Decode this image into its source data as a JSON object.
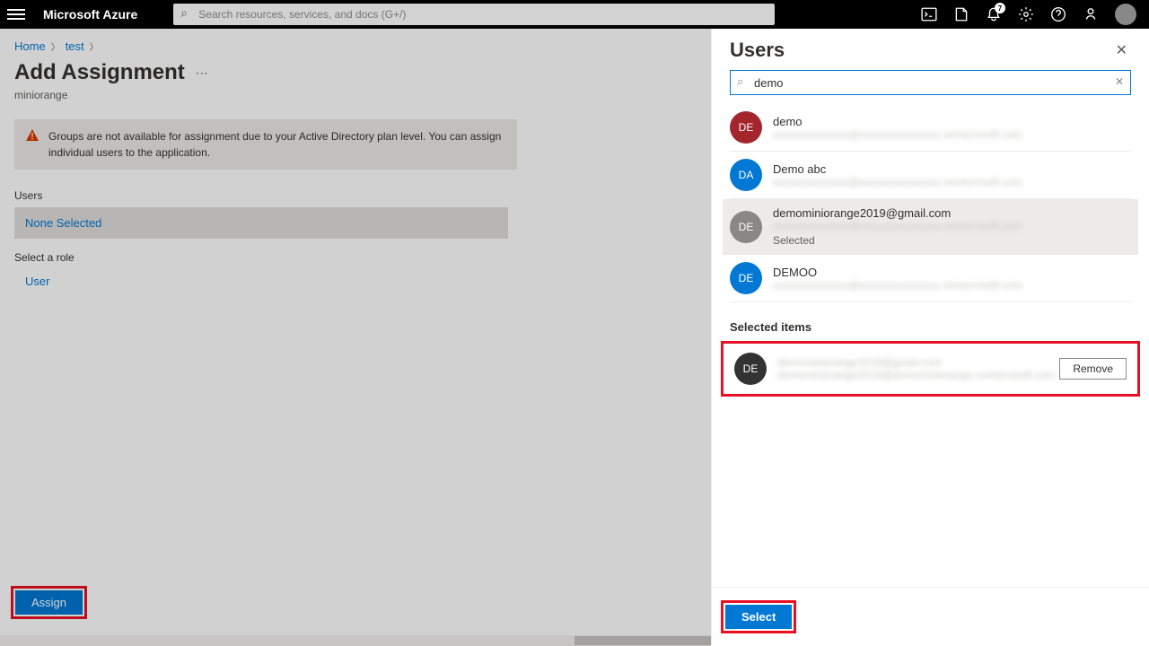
{
  "topbar": {
    "brand": "Microsoft Azure",
    "search_placeholder": "Search resources, services, and docs (G+/)",
    "notification_count": "7"
  },
  "breadcrumb": {
    "items": [
      "Home",
      "test"
    ]
  },
  "page": {
    "title": "Add Assignment",
    "subtitle": "miniorange",
    "warning": "Groups are not available for assignment due to your Active Directory plan level. You can assign individual users to the application."
  },
  "form": {
    "users_label": "Users",
    "users_value": "None Selected",
    "role_label": "Select a role",
    "role_value": "User"
  },
  "buttons": {
    "assign": "Assign",
    "select": "Select",
    "remove": "Remove"
  },
  "panel": {
    "title": "Users",
    "search_value": "demo",
    "selected_items_label": "Selected items",
    "results": [
      {
        "initials": "DE",
        "name": "demo",
        "color": "#a4262c",
        "selected": false
      },
      {
        "initials": "DA",
        "name": "Demo abc",
        "color": "#0078d4",
        "selected": false
      },
      {
        "initials": "DE",
        "name": "demominiorange2019@gmail.com",
        "color": "#8a8886",
        "selected": true,
        "status": "Selected"
      },
      {
        "initials": "DE",
        "name": "DEMOO",
        "color": "#0078d4",
        "selected": false
      }
    ],
    "selected_item": {
      "initials": "DE"
    }
  }
}
